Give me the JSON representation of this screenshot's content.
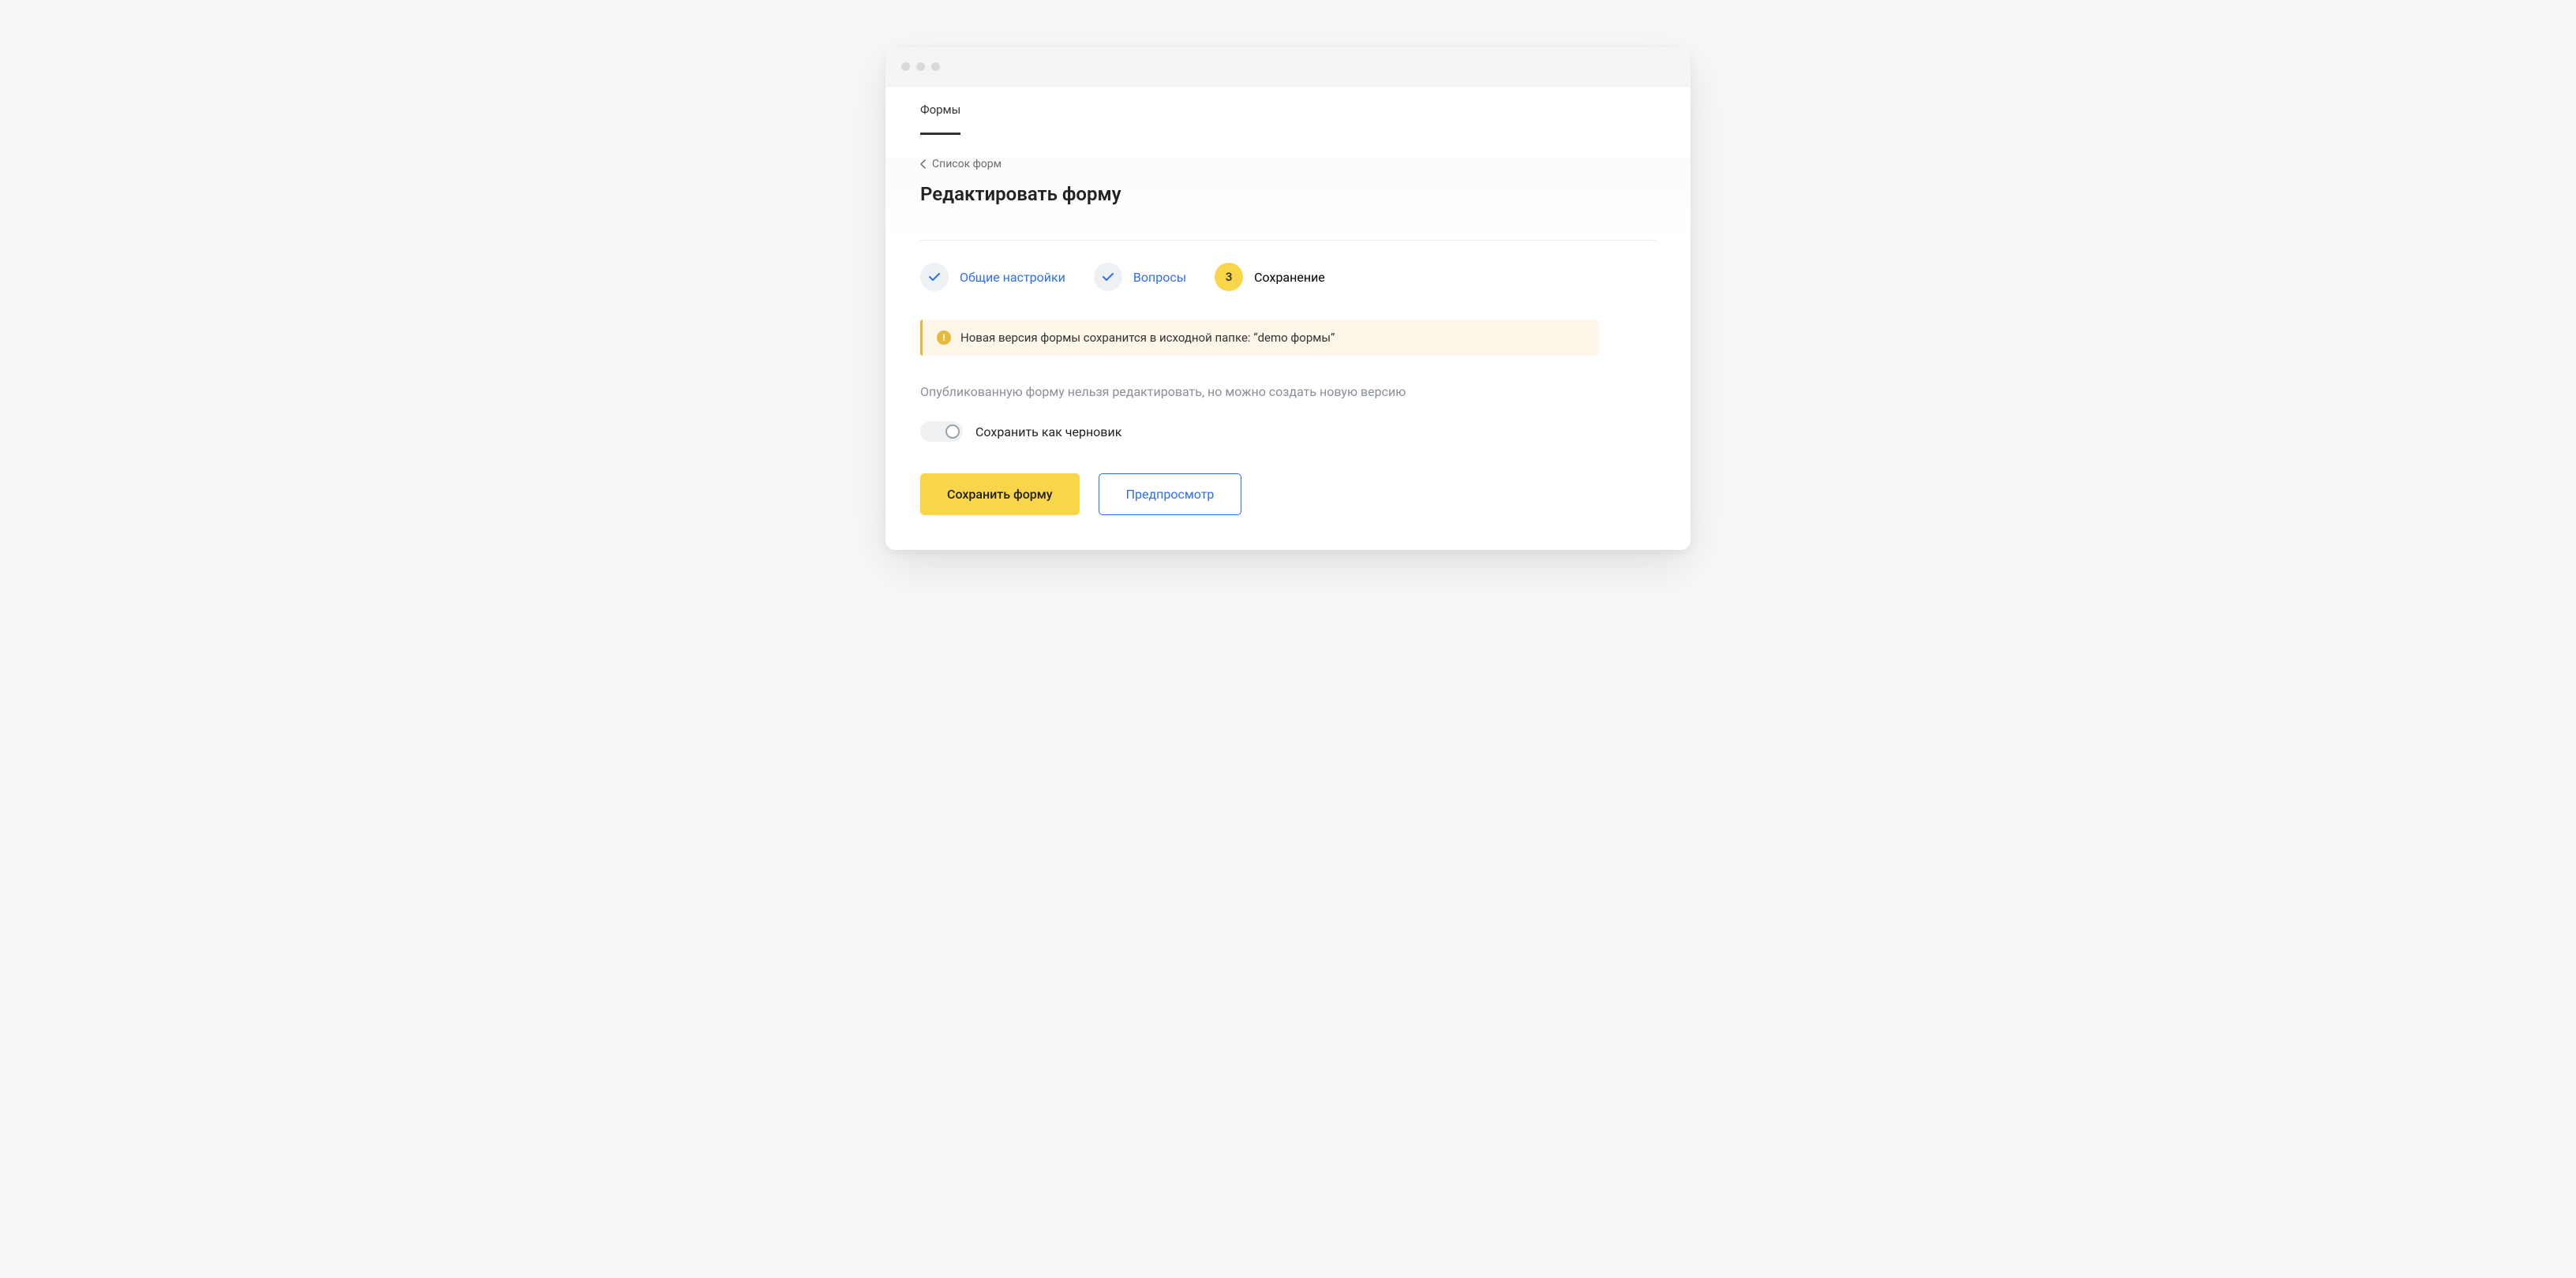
{
  "tabs": {
    "forms": "Формы"
  },
  "breadcrumb": {
    "label": "Список форм"
  },
  "page_title": "Редактировать форму",
  "stepper": {
    "step1": {
      "label": "Общие настройки"
    },
    "step2": {
      "label": "Вопросы"
    },
    "step3": {
      "number": "3",
      "label": "Сохранение"
    }
  },
  "notice": {
    "text": "Новая версия формы сохранится в исходной папке: “demo формы”"
  },
  "hint": "Опубликованную форму нельзя редактировать, но можно создать новую версию",
  "toggle": {
    "save_as_draft": "Сохранить как черновик"
  },
  "actions": {
    "save": "Сохранить форму",
    "preview": "Предпросмотр"
  }
}
